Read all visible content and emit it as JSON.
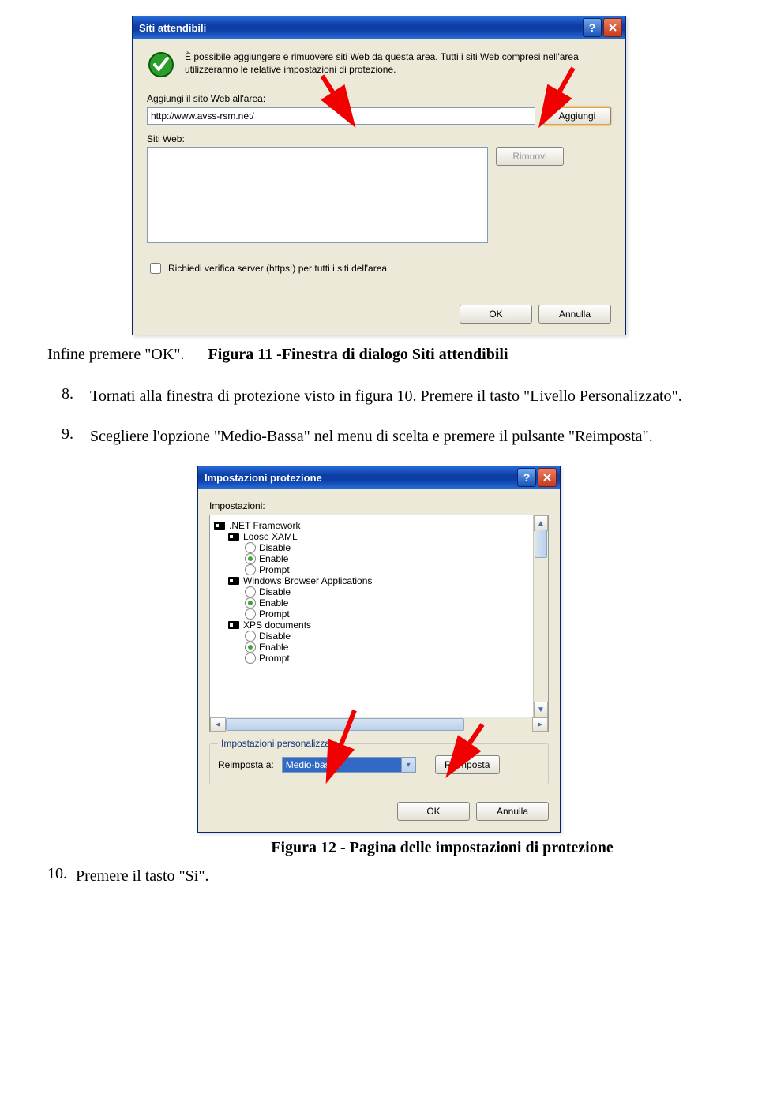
{
  "dialog1": {
    "title": "Siti attendibili",
    "intro": "È possibile aggiungere e rimuovere siti Web da questa area. Tutti i siti Web compresi nell'area utilizzeranno le relative impostazioni di protezione.",
    "add_label": "Aggiungi il sito Web all'area:",
    "url_value": "http://www.avss-rsm.net/",
    "add_button": "Aggiungi",
    "sites_label": "Siti Web:",
    "remove_button": "Rimuovi",
    "checkbox": "Richiedi verifica server (https:) per tutti i siti dell'area",
    "ok": "OK",
    "cancel": "Annulla"
  },
  "caption1": "Figura 11 -Finestra di dialogo Siti attendibili",
  "line_after": "Infine premere \"OK\".",
  "item8_num": "8.",
  "item8": "Tornati alla finestra di protezione visto in figura 10. Premere il tasto \"Livello Personalizzato\".",
  "item9_num": "9.",
  "item9": "Scegliere l'opzione \"Medio-Bassa\" nel menu di scelta e premere il pulsante \"Reimposta\".",
  "dialog2": {
    "title": "Impostazioni protezione",
    "set_label": "Impostazioni:",
    "tree": {
      "cat1": ".NET Framework",
      "cat1a": "Loose XAML",
      "cat1a_o1": "Disable",
      "cat1a_o2": "Enable",
      "cat1a_o3": "Prompt",
      "cat1b": "Windows Browser Applications",
      "cat1b_o1": "Disable",
      "cat1b_o2": "Enable",
      "cat1b_o3": "Prompt",
      "cat1c": "XPS documents",
      "cat1c_o1": "Disable",
      "cat1c_o2": "Enable",
      "cat1c_o3": "Prompt"
    },
    "fs_legend": "Impostazioni personalizzate",
    "reset_label": "Reimposta a:",
    "combo_value": "Medio-bassa",
    "reset_button": "Reimposta",
    "ok": "OK",
    "cancel": "Annulla"
  },
  "caption2": "Figura 12 - Pagina delle impostazioni di protezione",
  "item10_num": "10.",
  "item10": "Premere il tasto \"Si\"."
}
